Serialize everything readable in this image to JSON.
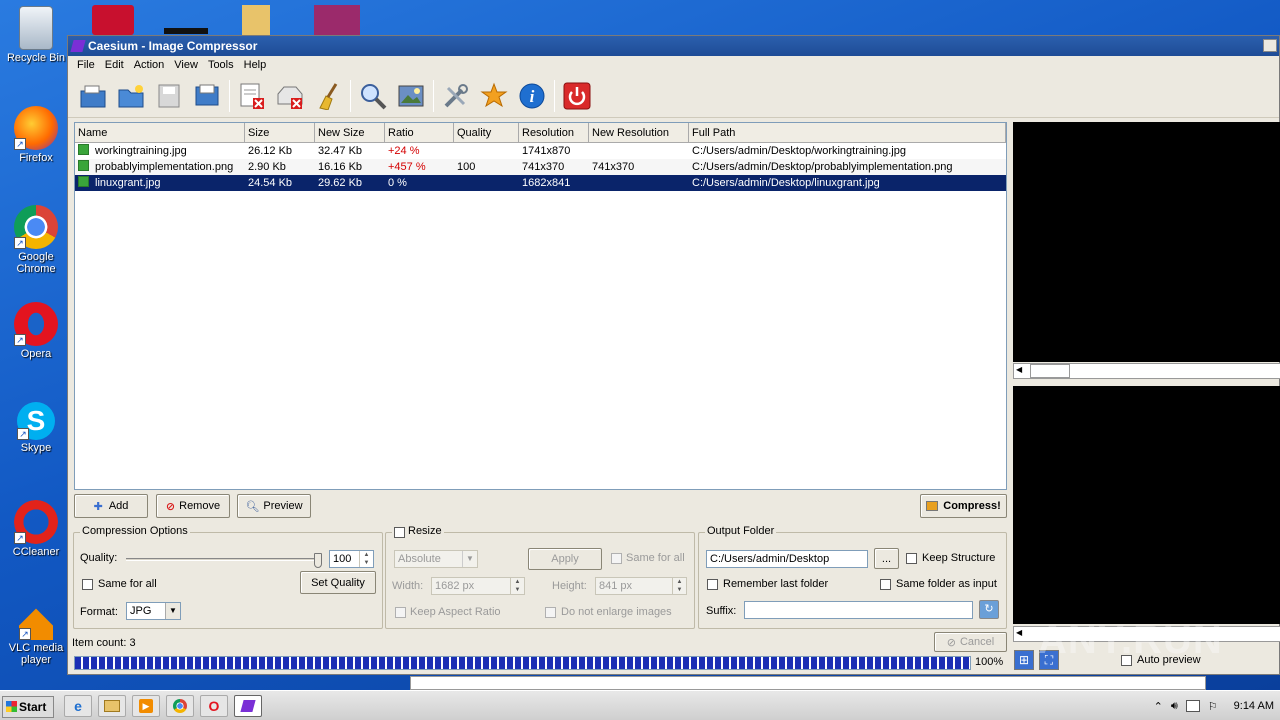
{
  "desktop": {
    "icons": [
      {
        "label": "Recycle Bin"
      },
      {
        "label": "Firefox"
      },
      {
        "label": "Google Chrome"
      },
      {
        "label": "Opera"
      },
      {
        "label": "Skype"
      },
      {
        "label": "CCleaner"
      },
      {
        "label": "VLC media player"
      }
    ]
  },
  "window": {
    "title": "Caesium - Image Compressor",
    "menu": [
      "File",
      "Edit",
      "Action",
      "View",
      "Tools",
      "Help"
    ],
    "toolbar_icons": [
      "open-files-icon",
      "open-folder-icon",
      "save-icon",
      "export-icon",
      "remove-item-icon",
      "clear-list-icon",
      "clean-icon",
      "zoom-icon",
      "preview-image-icon",
      "settings-icon",
      "update-icon",
      "info-icon",
      "exit-icon"
    ]
  },
  "list": {
    "columns": [
      "Name",
      "Size",
      "New Size",
      "Ratio",
      "Quality",
      "Resolution",
      "New Resolution",
      "Full Path"
    ],
    "rows": [
      {
        "name": "workingtraining.jpg",
        "size": "26.12 Kb",
        "new_size": "32.47 Kb",
        "ratio": "+24 %",
        "quality": "",
        "resolution": "1741x870",
        "new_resolution": "",
        "path": "C:/Users/admin/Desktop/workingtraining.jpg"
      },
      {
        "name": "probablyimplementation.png",
        "size": "2.90 Kb",
        "new_size": "16.16 Kb",
        "ratio": "+457 %",
        "quality": "100",
        "resolution": "741x370",
        "new_resolution": "741x370",
        "path": "C:/Users/admin/Desktop/probablyimplementation.png"
      },
      {
        "name": "linuxgrant.jpg",
        "size": "24.54 Kb",
        "new_size": "29.62 Kb",
        "ratio": "0 %",
        "quality": "",
        "resolution": "1682x841",
        "new_resolution": "",
        "path": "C:/Users/admin/Desktop/linuxgrant.jpg"
      }
    ]
  },
  "buttons": {
    "add": "Add",
    "remove": "Remove",
    "preview": "Preview",
    "compress": "Compress!"
  },
  "compression": {
    "title": "Compression Options",
    "quality_label": "Quality:",
    "quality_value": "100",
    "quality_fraction": 1.0,
    "same_for_all": "Same for all",
    "set_quality": "Set Quality",
    "format_label": "Format:",
    "format_value": "JPG"
  },
  "resize": {
    "title": "Resize",
    "mode": "Absolute",
    "apply": "Apply",
    "same_for_all": "Same for all",
    "width_label": "Width:",
    "width_value": "1682 px",
    "height_label": "Height:",
    "height_value": "841 px",
    "keep_aspect": "Keep Aspect Ratio",
    "no_enlarge": "Do not enlarge images"
  },
  "output": {
    "title": "Output Folder",
    "path": "C:/Users/admin/Desktop",
    "browse": "...",
    "keep_structure": "Keep Structure",
    "remember_last": "Remember last folder",
    "same_as_input": "Same folder as input",
    "suffix_label": "Suffix:",
    "suffix_value": ""
  },
  "status": {
    "item_count": "Item count: 3",
    "cancel": "Cancel",
    "progress_text": "100%",
    "progress_fraction": 1.0,
    "auto_preview": "Auto preview"
  },
  "taskbar": {
    "start": "Start",
    "clock": "9:14 AM"
  },
  "watermark": "ANY.RUN"
}
